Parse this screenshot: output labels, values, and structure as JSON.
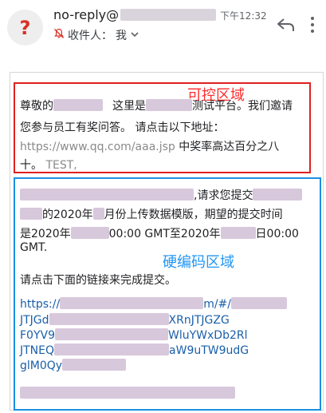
{
  "header": {
    "avatar_glyph": "?",
    "sender_prefix": "no-reply@",
    "time": "下午12:32",
    "recipient_label": "收件人：",
    "recipient_value": "我",
    "icons": [
      "question-avatar",
      "no-notification-icon",
      "chevron-down-icon",
      "reply-icon",
      "more-icon"
    ]
  },
  "annotations": {
    "controllable": "可控区域",
    "hardcoded": "硬编码区域"
  },
  "red_section": {
    "l1a": "尊敬的",
    "l1b": "这里是",
    "l1c": "测试平台。我们邀请",
    "l2": "您参与员工有奖问答。 请点击以下地址：",
    "l3_url": "https://www.qq.com/aaa.jsp",
    "l3_text": "中奖率高达百分之八",
    "l4a": "十。",
    "l4b": "TEST,"
  },
  "blue_section": {
    "l1": ",请求您提交",
    "l2a": "的2020年",
    "l2b": "月份上传数据模版，期望的提交时间",
    "l3a": "是2020年",
    "l3b": "00:00 GMT至2020年",
    "l3c": "日00:00",
    "l4": "GMT.",
    "l5": "请点击下面的链接来完成提交。",
    "url1a": "https://",
    "url1b": "m/#/",
    "url2a": "JTJGd",
    "url2b": "XRnJTJGZG",
    "url3a": "F0YV9",
    "url3b": "WluYWxDb2Rl",
    "url4a": "JTNEQ",
    "url4b": "aW9uTW9udG",
    "url5": "glM0Qy"
  },
  "colors": {
    "red_box": "#e02020",
    "blue_box": "#1a8fe0",
    "link": "#1a5fa8"
  }
}
